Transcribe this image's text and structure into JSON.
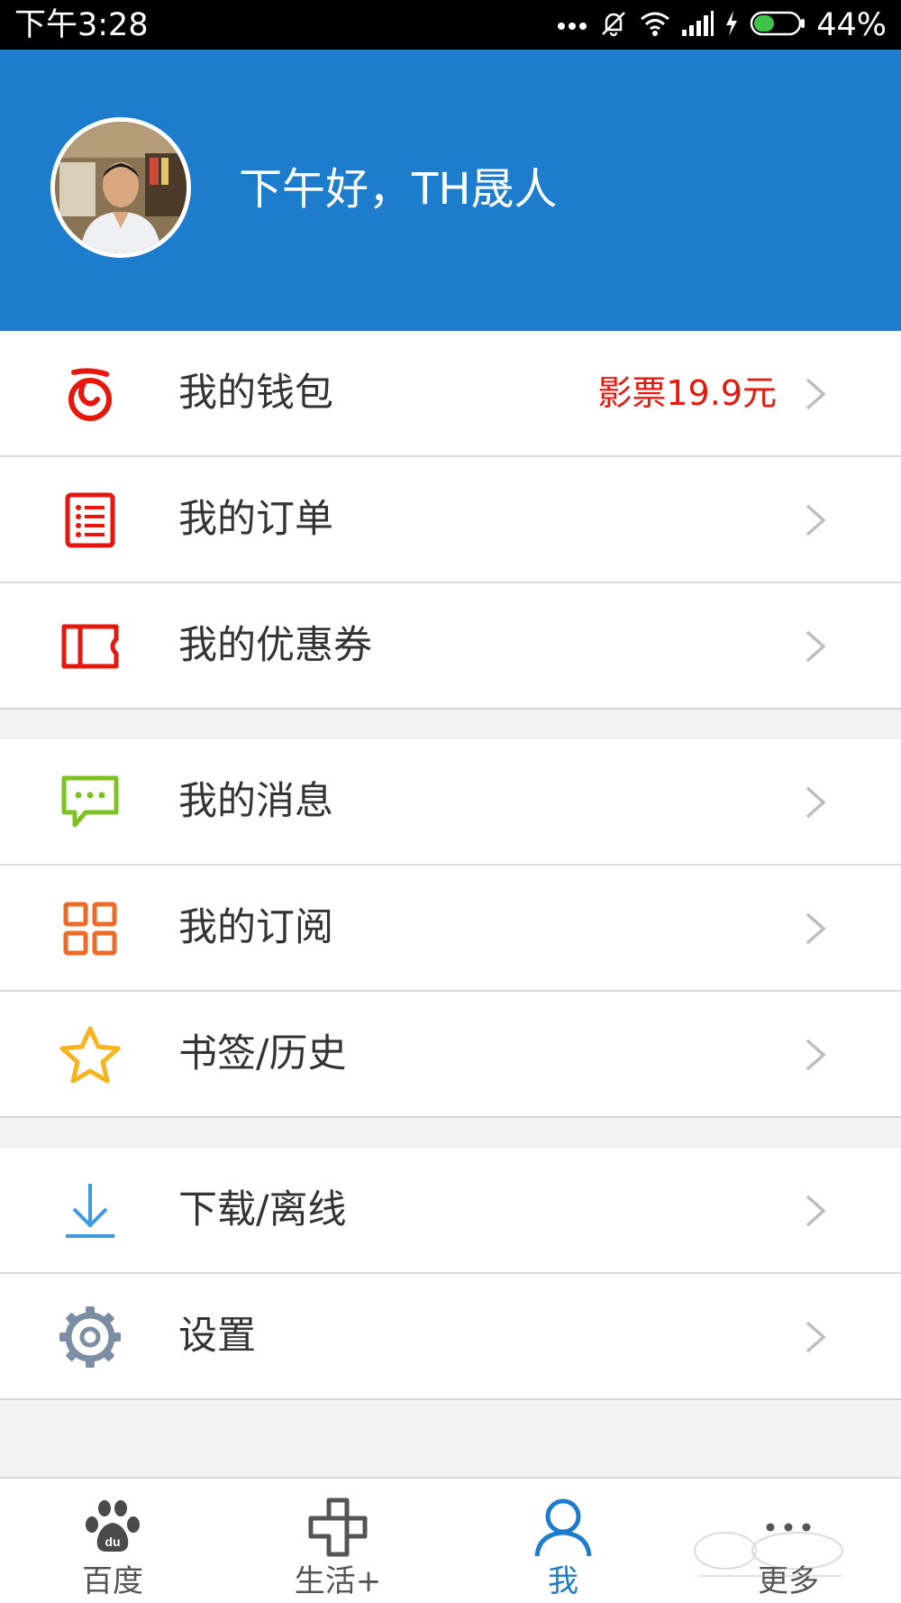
{
  "status_bar": {
    "time": "下午3:28",
    "battery": "44%",
    "icons": [
      "more-dots-icon",
      "mute-bell-icon",
      "wifi-icon",
      "signal-icon",
      "charging-icon",
      "battery-icon"
    ]
  },
  "header": {
    "greeting": "下午好，TH晟人",
    "background_color": "#1e7ccd"
  },
  "groups": [
    {
      "items": [
        {
          "label": "我的钱包",
          "value": "影票19.9元",
          "icon": "wallet-icon",
          "icon_color": "#e8160c"
        },
        {
          "label": "我的订单",
          "value": "",
          "icon": "order-list-icon",
          "icon_color": "#e8160c"
        },
        {
          "label": "我的优惠券",
          "value": "",
          "icon": "coupon-icon",
          "icon_color": "#e8160c"
        }
      ]
    },
    {
      "items": [
        {
          "label": "我的消息",
          "value": "",
          "icon": "message-icon",
          "icon_color": "#7cc220"
        },
        {
          "label": "我的订阅",
          "value": "",
          "icon": "grid-icon",
          "icon_color": "#f06a27"
        },
        {
          "label": "书签/历史",
          "value": "",
          "icon": "star-icon",
          "icon_color": "#f9b31d"
        }
      ]
    },
    {
      "items": [
        {
          "label": "下载/离线",
          "value": "",
          "icon": "download-icon",
          "icon_color": "#3a9ae8"
        },
        {
          "label": "设置",
          "value": "",
          "icon": "gear-icon",
          "icon_color": "#7b8ea3"
        }
      ]
    }
  ],
  "tabs": [
    {
      "label": "百度",
      "icon": "baidu-paw-icon",
      "active": false
    },
    {
      "label": "生活+",
      "icon": "life-plus-icon",
      "active": false
    },
    {
      "label": "我",
      "icon": "person-icon",
      "active": true
    },
    {
      "label": "更多",
      "icon": "more-dots-icon",
      "active": false
    }
  ],
  "colors": {
    "accent": "#1e7ccd",
    "value_red": "#e8160c"
  }
}
